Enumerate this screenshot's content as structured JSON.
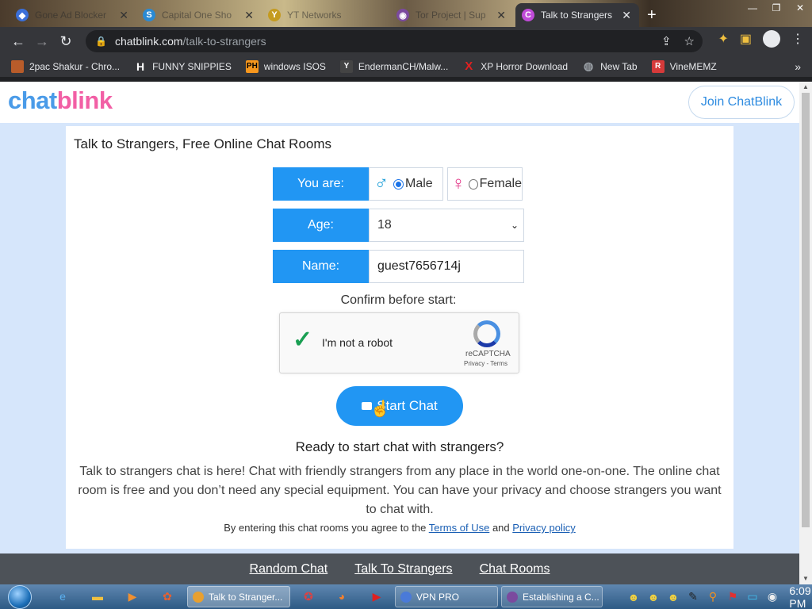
{
  "browser": {
    "tabs": [
      {
        "title": "Gone Ad Blocker",
        "icon": "shield-icon",
        "color": "#3b6fd8"
      },
      {
        "title": "Capital One Sho",
        "icon": "s-logo-icon",
        "color": "#2a8ad4"
      },
      {
        "title": "YT Networks",
        "icon": "yt-icon",
        "color": "#c49b20"
      },
      {
        "title": "Tor Project | Sup",
        "icon": "onion-icon",
        "color": "#7b4a9e"
      },
      {
        "title": "Talk to Strangers",
        "icon": "chatblink-icon",
        "color": "#c04bd8"
      }
    ],
    "tab_close": "✕",
    "new_tab": "+",
    "window_controls": {
      "minimize": "—",
      "maximize": "❐",
      "close": "✕"
    },
    "url_host": "chatblink.com",
    "url_path": "/talk-to-strangers",
    "nav": {
      "back": "←",
      "forward": "→",
      "reload": "↻"
    },
    "bookmarks": [
      {
        "label": "2pac Shakur - Chro...",
        "icon": "bookmark-image-icon",
        "color": "#b85c2a",
        "glyph": ""
      },
      {
        "label": "FUNNY SNIPPIES",
        "icon": "h-logo-icon",
        "color": "#ffffff",
        "glyph": "H"
      },
      {
        "label": "windows ISOS",
        "icon": "ph-logo-icon",
        "color": "#f7971d",
        "glyph": "PH"
      },
      {
        "label": "EndermanCH/Malw...",
        "icon": "yp-logo-icon",
        "color": "#444444",
        "glyph": "Y"
      },
      {
        "label": "XP Horror Download",
        "icon": "x-logo-icon",
        "color": "#e02020",
        "glyph": "X"
      },
      {
        "label": "New Tab",
        "icon": "globe-icon",
        "color": "#9aa0a6",
        "glyph": "◍"
      },
      {
        "label": "VineMEMZ",
        "icon": "r-logo-icon",
        "color": "#d63a3a",
        "glyph": "R"
      }
    ],
    "bookmarks_more": "»"
  },
  "site": {
    "logo_chat": "chat",
    "logo_blink": "blink",
    "join_button": "Join ChatBlink",
    "card_title": "Talk to Strangers, Free Online Chat Rooms",
    "you_are_label": "You are:",
    "male_label": "Male",
    "female_label": "Female",
    "gender_selected": "Male",
    "age_label": "Age:",
    "age_value": "18",
    "name_label": "Name:",
    "name_value": "guest7656714j",
    "confirm_text": "Confirm before start:",
    "captcha_text": "I'm not a robot",
    "captcha_brand": "reCAPTCHA",
    "captcha_links": "Privacy - Terms",
    "start_button": "Start Chat",
    "ready_heading": "Ready to start chat with strangers?",
    "description": "Talk to strangers chat is here! Chat with friendly strangers from any place in the world one-on-one. The online chat room is free and you don’t need any special equipment. You can have your privacy and choose strangers you want to chat with.",
    "agree_prefix": "By entering this chat rooms you agree to the",
    "terms_link": "Terms of Use",
    "agree_and": "and",
    "privacy_link": "Privacy policy",
    "footer_links": [
      "Random Chat",
      "Talk To Strangers",
      "Chat Rooms"
    ]
  },
  "taskbar": {
    "tasks": [
      {
        "label": "Talk to Stranger...",
        "color": "#e8a030"
      },
      {
        "label": "VPN PRO",
        "color": "#4a7ad8"
      },
      {
        "label": "Establishing a C...",
        "color": "#7b4a9e"
      }
    ],
    "clock": "6:09 PM"
  },
  "colors": {
    "accent": "#2196f3",
    "logo_blue": "#4a9be8",
    "logo_pink": "#f25fa5",
    "page_bg": "#d6e6fb",
    "footer_bg": "#4d5258"
  }
}
